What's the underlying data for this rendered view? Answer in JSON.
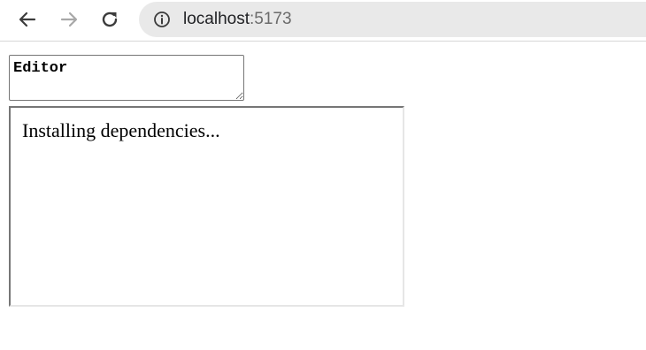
{
  "browser": {
    "address_bar": {
      "host": "localhost",
      "port": ":5173"
    },
    "icons": {
      "back": "back-arrow-icon",
      "forward": "forward-arrow-icon",
      "reload": "reload-icon",
      "site_info": "info-icon"
    }
  },
  "page": {
    "editor": {
      "value": "Editor"
    },
    "output": {
      "status_text": "Installing dependencies..."
    }
  }
}
